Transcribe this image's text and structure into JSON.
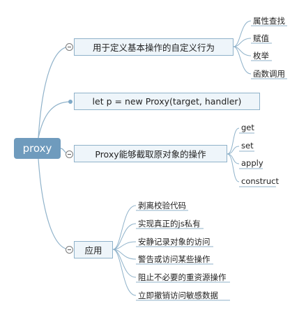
{
  "root": {
    "label": "proxy"
  },
  "branches": [
    {
      "label": "用于定义基本操作的自定义行为",
      "children": [
        "属性查找",
        "赋值",
        "枚举",
        "函数调用"
      ]
    },
    {
      "label": "let p = new Proxy(target, handler)",
      "children": []
    },
    {
      "label": "Proxy能够截取原对象的操作",
      "children": [
        "get",
        "set",
        "apply",
        "construct"
      ]
    },
    {
      "label": "应用",
      "children": [
        "剥离校验代码",
        "实现真正的js私有",
        "安静记录对象的访问",
        "警告或访问某些操作",
        "阻止不必要的重资源操作",
        "立即撤销访问敏感数据"
      ]
    }
  ],
  "colors": {
    "root_fill": "#6f9bbd",
    "box_fill": "#eef5fa",
    "box_border": "#8fb2ca",
    "line": "#8fb2ca"
  }
}
